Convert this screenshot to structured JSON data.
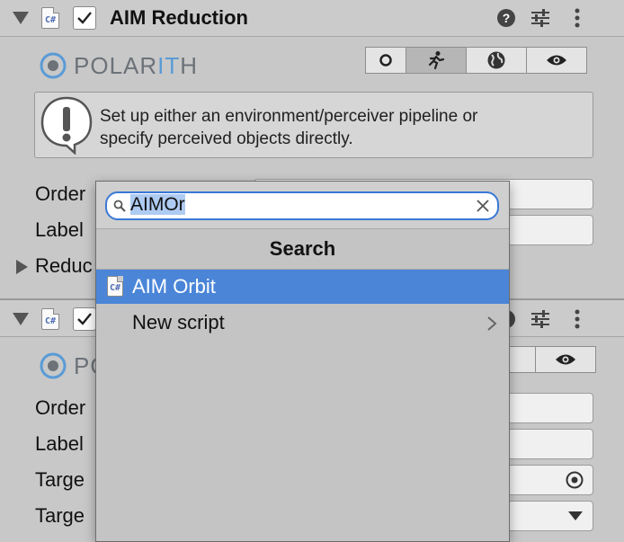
{
  "component1": {
    "title": "AIM Reduction",
    "script_icon": "C#",
    "enabled": true
  },
  "logo": {
    "prefix": "POLAR",
    "highlight": "IT",
    "suffix": "H"
  },
  "toolbar_icons": [
    "circle-icon",
    "running-person-icon",
    "globe-icon",
    "eye-icon"
  ],
  "help_message": {
    "line1": "Set up either an environment/perceiver pipeline or",
    "line2": "specify perceived objects directly."
  },
  "properties1": {
    "order": "Order",
    "label": "Label",
    "reduction": "Reduc"
  },
  "component2": {
    "script_icon": "C#",
    "enabled": true,
    "logo_partial": "PO"
  },
  "properties2": {
    "order": "Order",
    "label": "Label",
    "target1": "Targe",
    "target2": "Targe"
  },
  "popup": {
    "search_value": "AIMOr",
    "header": "Search",
    "items": [
      {
        "label": "AIM Orbit",
        "icon": "C#",
        "selected": true
      },
      {
        "label": "New script",
        "icon": "",
        "selected": false
      }
    ]
  },
  "colors": {
    "selection": "#4a85d8",
    "search_focus": "#3a79d6",
    "logo_blue": "#5a9bd6"
  }
}
